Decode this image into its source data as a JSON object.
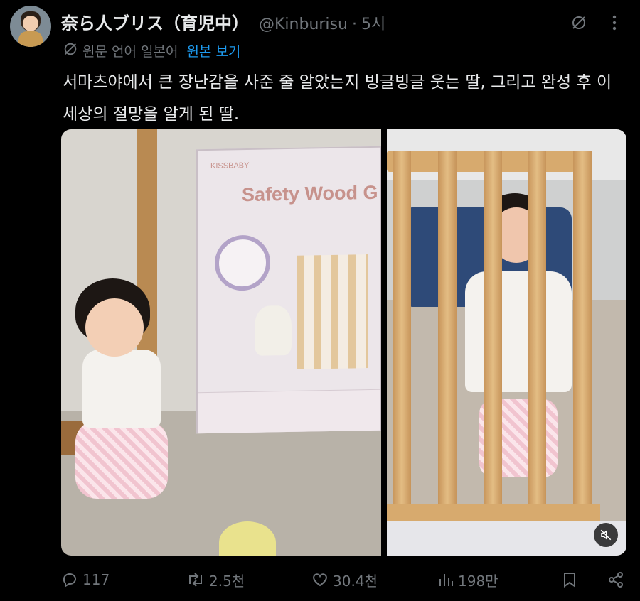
{
  "tweet": {
    "author_name": "奈ら人ブリス（育児中）",
    "author_handle": "@Kinburisu",
    "separator": "·",
    "time": "5시",
    "translation": {
      "meta": "원문 언어 일본어",
      "link": "원본 보기"
    },
    "text": "서마츠야에서 큰 장난감을 사준 줄 알았는지 빙글빙글 웃는 딸, 그리고 완성 후 이 세상의 절망을 알게 된 딸.",
    "media": {
      "box_brand": "KISSBABY",
      "box_title": "Safety Wood G"
    },
    "actions": {
      "replies": "117",
      "reposts": "2.5천",
      "likes": "30.4천",
      "views": "198만"
    }
  },
  "icons": {
    "translate": "translate-icon",
    "more": "more-icon",
    "mute": "mute-icon",
    "reply": "reply-icon",
    "repost": "repost-icon",
    "like": "like-icon",
    "views": "views-icon",
    "bookmark": "bookmark-icon",
    "share": "share-icon"
  },
  "colors": {
    "background": "#000000",
    "text": "#e7e9ea",
    "muted": "#71767b",
    "link": "#1d9bf0"
  }
}
